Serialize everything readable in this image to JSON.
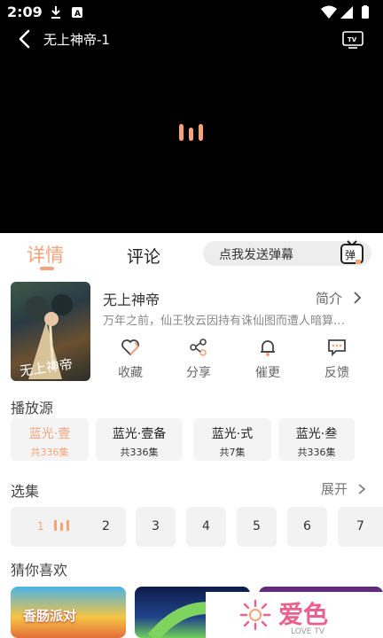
{
  "status_bar": {
    "time": "2:09"
  },
  "player": {
    "title": "无上神帝-1"
  },
  "tabs": {
    "detail": "详情",
    "comment": "评论"
  },
  "danmaku": {
    "placeholder": "点我发送弹幕",
    "button": "弹"
  },
  "show": {
    "title": "无上神帝",
    "intro_label": "简介",
    "description": "万年之前，仙王牧云因持有诛仙图而遭人暗算…",
    "poster_text": "无上神帝"
  },
  "actions": [
    {
      "label": "收藏",
      "icon": "heart-icon"
    },
    {
      "label": "分享",
      "icon": "share-icon"
    },
    {
      "label": "催更",
      "icon": "bell-icon"
    },
    {
      "label": "反馈",
      "icon": "feedback-icon"
    }
  ],
  "sources": {
    "title": "播放源",
    "items": [
      {
        "name": "蓝光·壹",
        "count": "共336集"
      },
      {
        "name": "蓝光·壹备",
        "count": "共336集"
      },
      {
        "name": "蓝光·式",
        "count": "共7集"
      },
      {
        "name": "蓝光·叁",
        "count": "共336集"
      }
    ]
  },
  "episodes": {
    "title": "选集",
    "expand": "展开",
    "items": [
      "1",
      "2",
      "3",
      "4",
      "5",
      "6",
      "7"
    ]
  },
  "recommend": {
    "title": "猜你喜欢",
    "first_badge": "香肠派对"
  },
  "watermark": {
    "brand": "爱色",
    "sub": "LOVE TV"
  },
  "colors": {
    "accent": "#f5a37a",
    "player_bg": "#000000"
  }
}
